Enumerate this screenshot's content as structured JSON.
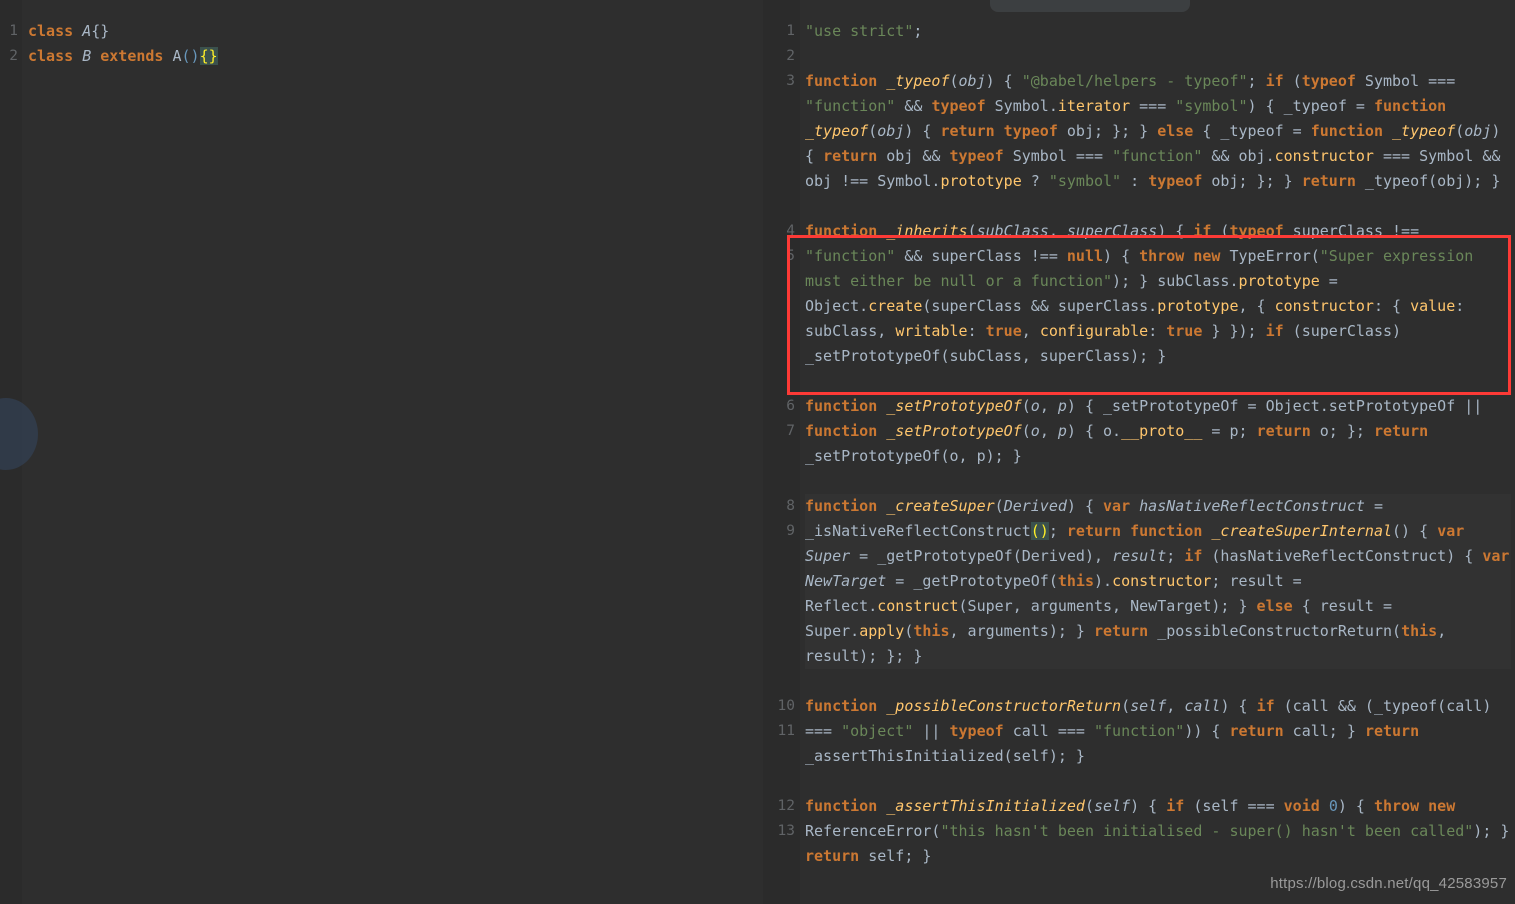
{
  "window": {
    "background_color": "#2b2b2b",
    "code_background_color": "#2e2e2e",
    "accent_highlight_color": "#fd3a36",
    "top_chip_label": ""
  },
  "watermark": {
    "text": "https://blog.csdn.net/qq_42583957"
  },
  "left_editor": {
    "name": "source-editor",
    "language": "JavaScript (ES6 class source)",
    "line_numbers": [
      "1",
      "2"
    ],
    "lines": [
      "class A{}",
      "class B extends A(){}"
    ]
  },
  "right_editor": {
    "name": "compiled-output-editor",
    "language": "JavaScript (Babel compiled output)",
    "line_numbers": [
      "1",
      "2",
      "3",
      "4",
      "5",
      "6",
      "7",
      "8",
      "9",
      "10",
      "11",
      "12",
      "13"
    ],
    "lines": [
      "\"use strict\";",
      "",
      "function _typeof(obj) { \"@babel/helpers - typeof\"; if (typeof Symbol === \"function\" && typeof Symbol.iterator === \"symbol\") { _typeof = function _typeof(obj) { return typeof obj; }; } else { _typeof = function _typeof(obj) { return obj && typeof Symbol === \"function\" && obj.constructor === Symbol && obj !== Symbol.prototype ? \"symbol\" : typeof obj; }; } return _typeof(obj); }",
      "",
      "function _inherits(subClass, superClass) { if (typeof superClass !== \"function\" && superClass !== null) { throw new TypeError(\"Super expression must either be null or a function\"); } subClass.prototype = Object.create(superClass && superClass.prototype, { constructor: { value: subClass, writable: true, configurable: true } }); if (superClass) _setPrototypeOf(subClass, superClass); }",
      "",
      "function _setPrototypeOf(o, p) { _setPrototypeOf = Object.setPrototypeOf || function _setPrototypeOf(o, p) { o.__proto__ = p; return o; }; return _setPrototypeOf(o, p); }",
      "",
      "function _createSuper(Derived) { var hasNativeReflectConstruct = _isNativeReflectConstruct(); return function _createSuperInternal() { var Super = _getPrototypeOf(Derived), result; if (hasNativeReflectConstruct) { var NewTarget = _getPrototypeOf(this).constructor; result = Reflect.construct(Super, arguments, NewTarget); } else { result = Super.apply(this, arguments); } return _possibleConstructorReturn(this, result); }; }",
      "",
      "function _possibleConstructorReturn(self, call) { if (call && (_typeof(call) === \"object\" || typeof call === \"function\")) { return call; } return _assertThisInitialized(self); }",
      "",
      "function _assertThisInitialized(self) { if (self === void 0) { throw new ReferenceError(\"this hasn't been initialised - super() hasn't been called\"); } return self; }"
    ]
  },
  "annotation": {
    "name": "red-highlight-box",
    "targets_line": "5",
    "targets_function": "_inherits",
    "color": "#fd3a36"
  }
}
